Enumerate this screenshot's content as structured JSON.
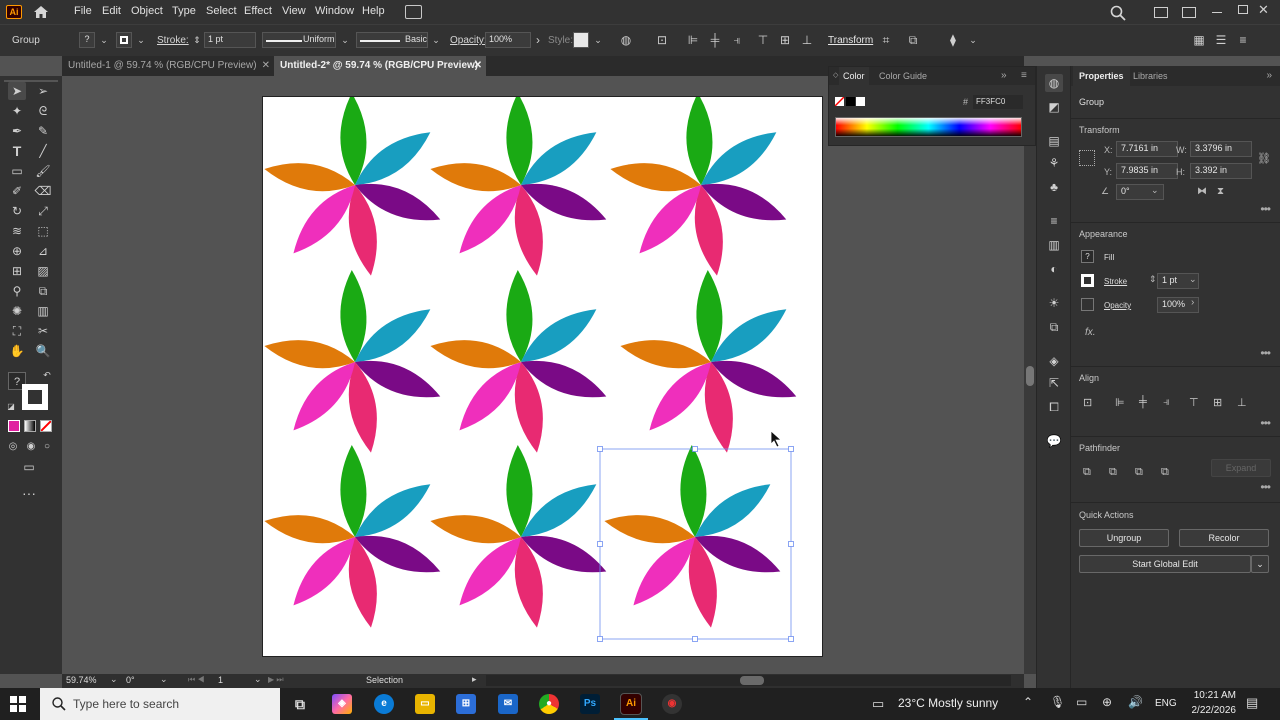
{
  "menubar": {
    "logo": "Ai",
    "items": [
      "File",
      "Edit",
      "Object",
      "Type",
      "Select",
      "Effect",
      "View",
      "Window",
      "Help"
    ]
  },
  "control": {
    "selection_type": "Group",
    "stroke_label": "Stroke:",
    "stroke_weight": "1 pt",
    "profile": "Uniform",
    "brush": "Basic",
    "opacity_label": "Opacity:",
    "opacity_value": "100%",
    "style_label": "Style:",
    "transform_link": "Transform"
  },
  "tabs": [
    {
      "label": "Untitled-1 @ 59.74 % (RGB/CPU Preview)",
      "active": false
    },
    {
      "label": "Untitled-2* @ 59.74 % (RGB/CPU Preview)",
      "active": true
    }
  ],
  "color_panel": {
    "tabs": [
      "Color",
      "Color Guide"
    ],
    "hex_prefix": "#",
    "hex": "FF3FC0"
  },
  "properties": {
    "tabs": [
      "Properties",
      "Libraries"
    ],
    "object_type": "Group",
    "transform": {
      "title": "Transform",
      "x_label": "X:",
      "x": "7.7161 in",
      "y_label": "Y:",
      "y": "7.9835 in",
      "w_label": "W:",
      "w": "3.3796 in",
      "h_label": "H:",
      "h": "3.392 in",
      "angle": "0°"
    },
    "appearance": {
      "title": "Appearance",
      "fill_label": "Fill",
      "stroke_label": "Stroke",
      "stroke_value": "1 pt",
      "opacity_label": "Opacity",
      "opacity_value": "100%",
      "fx": "fx."
    },
    "align_title": "Align",
    "pathfinder": {
      "title": "Pathfinder",
      "expand": "Expand"
    },
    "quick_actions": {
      "title": "Quick Actions",
      "ungroup": "Ungroup",
      "recolor": "Recolor",
      "global_edit": "Start Global Edit"
    }
  },
  "status": {
    "zoom": "59.74%",
    "rotation": "0°",
    "artboard": "1",
    "tool": "Selection"
  },
  "flower_colors": {
    "orange": "#e07a0a",
    "green": "#1aaa14",
    "teal": "#189ec0",
    "purple": "#7a0a86",
    "pink": "#e82a72",
    "magenta": "#ef2fbc"
  },
  "taskbar": {
    "search_placeholder": "Type here to search",
    "weather": "23°C  Mostly sunny",
    "language": "ENG",
    "time": "10:21 AM",
    "date": "2/22/2026"
  }
}
